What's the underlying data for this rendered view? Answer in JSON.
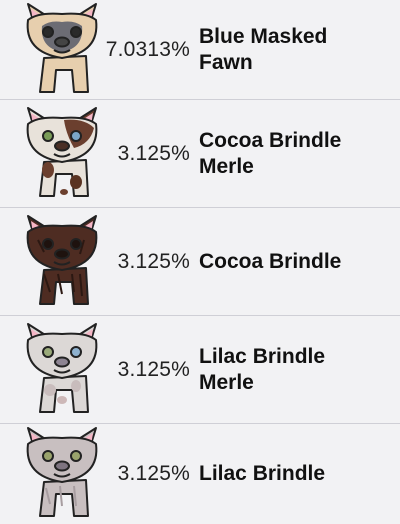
{
  "rows": [
    {
      "percent": "7.0313%",
      "name_line1": "Blue Masked",
      "name_line2": "Fawn",
      "coat": "fawn",
      "mask": "#6c6c74"
    },
    {
      "percent": "3.125%",
      "name_line1": "Cocoa Brindle",
      "name_line2": "Merle",
      "coat": "cocoa-merle"
    },
    {
      "percent": "3.125%",
      "name_line1": "Cocoa Brindle",
      "name_line2": "",
      "coat": "cocoa-brindle"
    },
    {
      "percent": "3.125%",
      "name_line1": "Lilac Brindle",
      "name_line2": "Merle",
      "coat": "lilac-merle"
    },
    {
      "percent": "3.125%",
      "name_line1": "Lilac Brindle",
      "name_line2": "",
      "coat": "lilac-brindle"
    }
  ],
  "colors": {
    "background": "#f2f2f4",
    "divider": "#cfcfd6",
    "ear_inner": "#f5b6c6"
  }
}
